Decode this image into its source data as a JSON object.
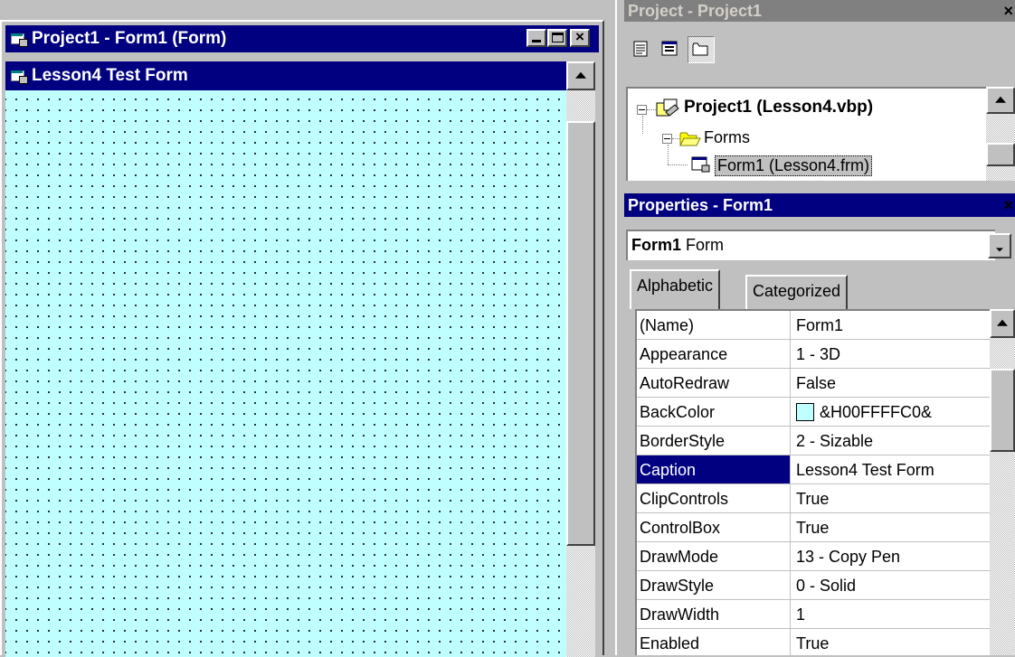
{
  "designer": {
    "window_title": "Project1 - Form1 (Form)",
    "form_caption": "Lesson4 Test Form",
    "back_color": "#c0ffff"
  },
  "project": {
    "title": "Project - Project1",
    "close_glyph": "×",
    "toolbar": [
      {
        "icon": "view-code-icon"
      },
      {
        "icon": "view-object-icon"
      },
      {
        "icon": "toggle-folders-icon"
      }
    ],
    "tree": {
      "project_label": "Project1 (Lesson4.vbp)",
      "forms_label": "Forms",
      "form_label": "Form1 (Lesson4.frm)"
    }
  },
  "properties": {
    "title": "Properties - Form1",
    "close_glyph": "×",
    "object_name": "Form1",
    "object_type": "Form",
    "tabs": [
      "Alphabetic",
      "Categorized"
    ],
    "selected_property": "Caption",
    "rows": [
      {
        "name": "(Name)",
        "value": "Form1"
      },
      {
        "name": "Appearance",
        "value": "1 - 3D"
      },
      {
        "name": "AutoRedraw",
        "value": "False"
      },
      {
        "name": "BackColor",
        "value": "&H00FFFFC0&"
      },
      {
        "name": "BorderStyle",
        "value": "2 - Sizable"
      },
      {
        "name": "Caption",
        "value": "Lesson4 Test Form"
      },
      {
        "name": "ClipControls",
        "value": "True"
      },
      {
        "name": "ControlBox",
        "value": "True"
      },
      {
        "name": "DrawMode",
        "value": "13 - Copy Pen"
      },
      {
        "name": "DrawStyle",
        "value": "0 - Solid"
      },
      {
        "name": "DrawWidth",
        "value": "1"
      },
      {
        "name": "Enabled",
        "value": "True"
      }
    ]
  }
}
